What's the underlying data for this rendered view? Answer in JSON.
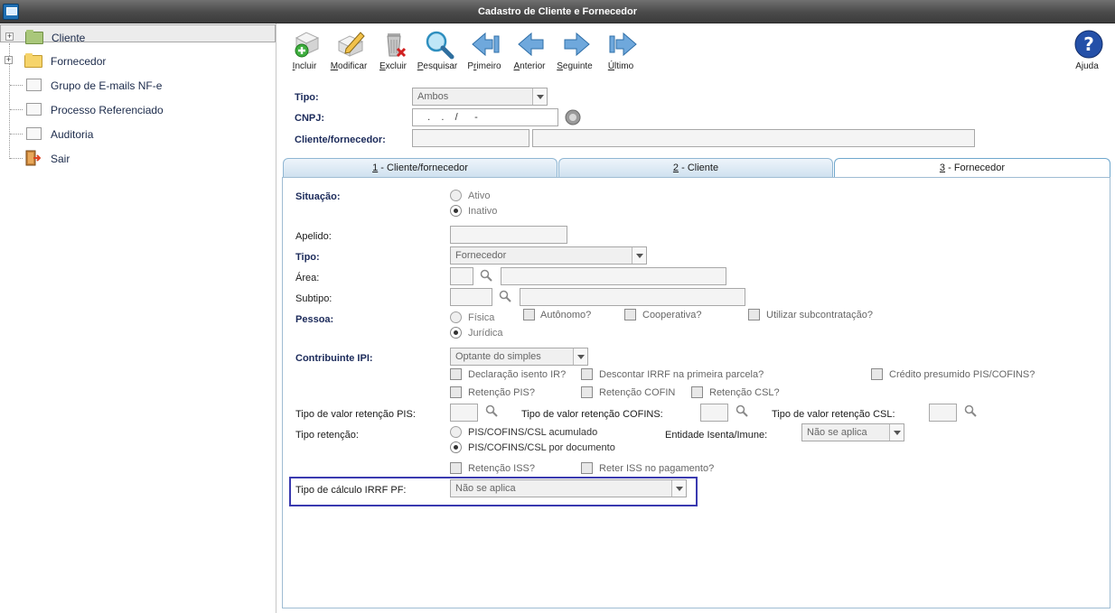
{
  "window": {
    "title": "Cadastro de Cliente e Fornecedor"
  },
  "tree": {
    "items": [
      {
        "label": "Cliente",
        "icon": "folder-green-icon",
        "expander": "+"
      },
      {
        "label": "Fornecedor",
        "icon": "folder-yellow-icon",
        "expander": "+"
      },
      {
        "label": "Grupo de E-mails NF-e",
        "icon": "document-icon"
      },
      {
        "label": "Processo Referenciado",
        "icon": "document-icon"
      },
      {
        "label": "Auditoria",
        "icon": "document-icon"
      },
      {
        "label": "Sair",
        "icon": "exit-door-icon"
      }
    ]
  },
  "toolbar": {
    "incluir": {
      "pre": "",
      "key": "I",
      "post": "ncluir"
    },
    "modificar": {
      "pre": "",
      "key": "M",
      "post": "odificar"
    },
    "excluir": {
      "pre": "",
      "key": "E",
      "post": "xcluir"
    },
    "pesquisar": {
      "pre": "",
      "key": "P",
      "post": "esquisar"
    },
    "primeiro": {
      "pre": "P",
      "key": "r",
      "post": "imeiro"
    },
    "anterior": {
      "pre": "",
      "key": "A",
      "post": "nterior"
    },
    "seguinte": {
      "pre": "",
      "key": "S",
      "post": "eguinte"
    },
    "ultimo": {
      "pre": "",
      "key": "Ú",
      "post": "ltimo"
    },
    "ajuda": "Ajuda"
  },
  "header_form": {
    "tipo_label": "Tipo:",
    "tipo_value": "Ambos",
    "cnpj_label": "CNPJ:",
    "cnpj_value": "  .    .    /      -",
    "cliente_label": "Cliente/fornecedor:"
  },
  "tabs": [
    {
      "key": "1",
      "label": " - Cliente/fornecedor"
    },
    {
      "key": "2",
      "label": " - Cliente"
    },
    {
      "key": "3",
      "label": " - Fornecedor"
    }
  ],
  "fornecedor": {
    "situacao_label": "Situação:",
    "situacao_options": [
      "Ativo",
      "Inativo"
    ],
    "apelido_label": "Apelido:",
    "tipo_label": "Tipo:",
    "tipo_value": "Fornecedor",
    "area_label": "Área:",
    "subtipo_label": "Subtipo:",
    "pessoa_label": "Pessoa:",
    "pessoa_options": [
      "Física",
      "Jurídica"
    ],
    "autonomo": "Autônomo?",
    "cooperativa": "Cooperativa?",
    "subcontratacao": "Utilizar subcontratação?",
    "contribuinte_ipi_label": "Contribuinte IPI:",
    "contribuinte_ipi_value": "Optante do simples",
    "declaracao_isento": "Declaração isento IR?",
    "descontar_irrf": "Descontar IRRF na primeira parcela?",
    "credito_presumido": "Crédito presumido PIS/COFINS?",
    "retencao_pis": "Retenção PIS?",
    "retencao_cofins": "Retenção COFINS",
    "retencao_csl": "Retenção CSL?",
    "tipo_valor_pis_label": "Tipo de valor retenção PIS:",
    "tipo_valor_cofins_label": "Tipo de valor retenção COFINS:",
    "tipo_valor_csl_label": "Tipo de valor retenção CSL:",
    "tipo_retencao_label": "Tipo retenção:",
    "tipo_retencao_options": [
      "PIS/COFINS/CSL acumulado",
      "PIS/COFINS/CSL por documento"
    ],
    "entidade_label": "Entidade Isenta/Imune:",
    "entidade_value": "Não se aplica",
    "retencao_iss": "Retenção ISS?",
    "reter_iss": "Reter ISS no pagamento?",
    "irrf_pf_label": "Tipo de cálculo IRRF PF:",
    "irrf_pf_value": "Não se aplica"
  }
}
